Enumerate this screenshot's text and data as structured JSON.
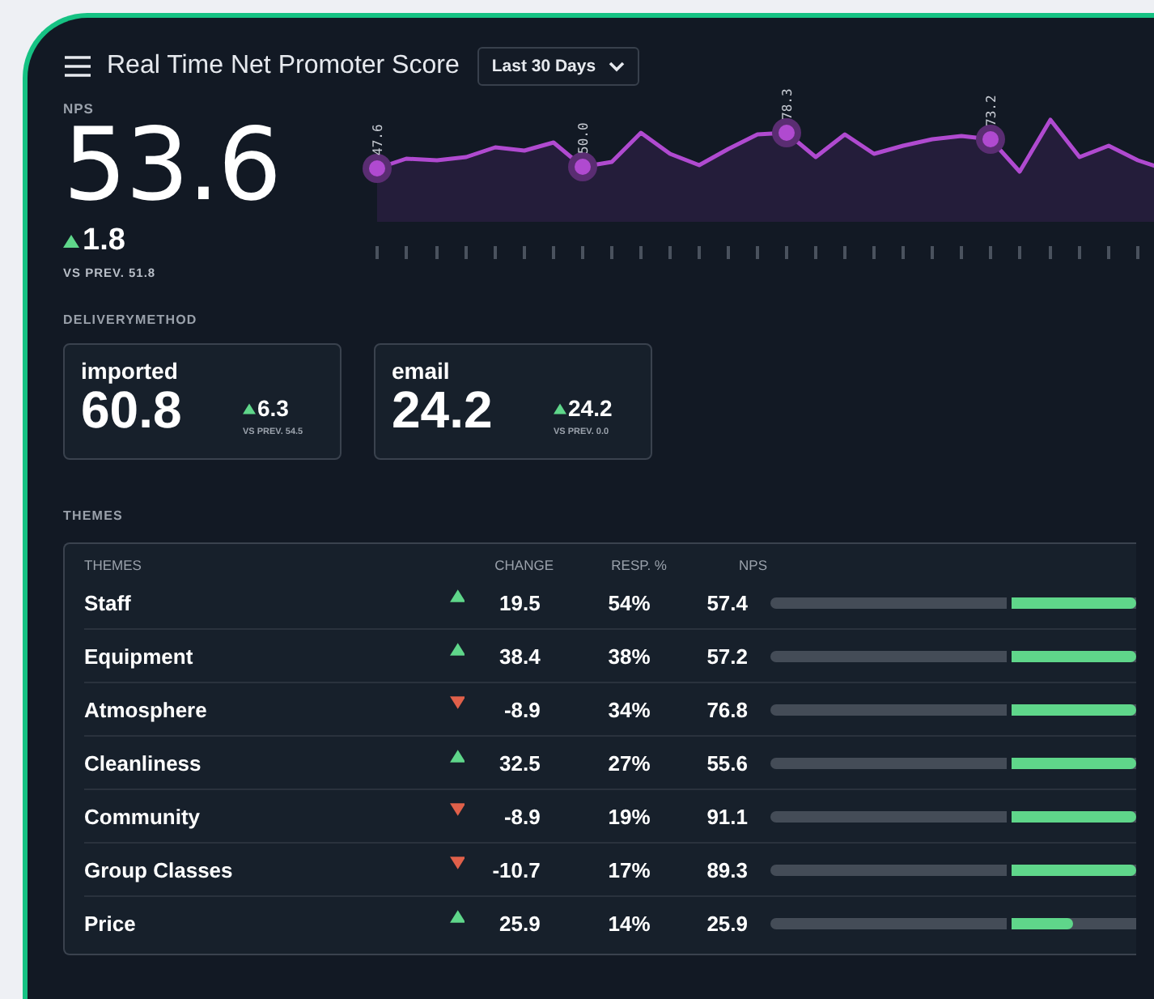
{
  "header": {
    "title": "Real Time Net Promoter Score",
    "range": "Last 30 Days"
  },
  "nps": {
    "label": "NPS",
    "value": "53.6",
    "change": "1.8",
    "rising": true,
    "previous": "VS PREV. 51.8"
  },
  "trend": {
    "point_labels": [
      "47.6",
      "50.0",
      "78.3",
      "73.2"
    ]
  },
  "delivery": {
    "label": "DELIVERYMETHOD",
    "cards": [
      {
        "name": "imported",
        "value": "60.8",
        "change": "6.3",
        "rising": true,
        "previous": "VS PREV. 54.5"
      },
      {
        "name": "email",
        "value": "24.2",
        "change": "24.2",
        "rising": true,
        "previous": "VS PREV. 0.0"
      }
    ]
  },
  "themes": {
    "label": "THEMES",
    "columns": [
      "THEMES",
      "CHANGE",
      "RESP. %",
      "NPS"
    ],
    "rows": [
      {
        "name": "Staff",
        "rising": true,
        "change": "19.5",
        "resp": "54%",
        "nps": "57.4"
      },
      {
        "name": "Equipment",
        "rising": true,
        "change": "38.4",
        "resp": "38%",
        "nps": "57.2"
      },
      {
        "name": "Atmosphere",
        "rising": false,
        "change": "-8.9",
        "resp": "34%",
        "nps": "76.8"
      },
      {
        "name": "Cleanliness",
        "rising": true,
        "change": "32.5",
        "resp": "27%",
        "nps": "55.6"
      },
      {
        "name": "Community",
        "rising": false,
        "change": "-8.9",
        "resp": "19%",
        "nps": "91.1"
      },
      {
        "name": "Group Classes",
        "rising": false,
        "change": "-10.7",
        "resp": "17%",
        "nps": "89.3"
      },
      {
        "name": "Price",
        "rising": true,
        "change": "25.9",
        "resp": "14%",
        "nps": "25.9"
      }
    ]
  }
}
